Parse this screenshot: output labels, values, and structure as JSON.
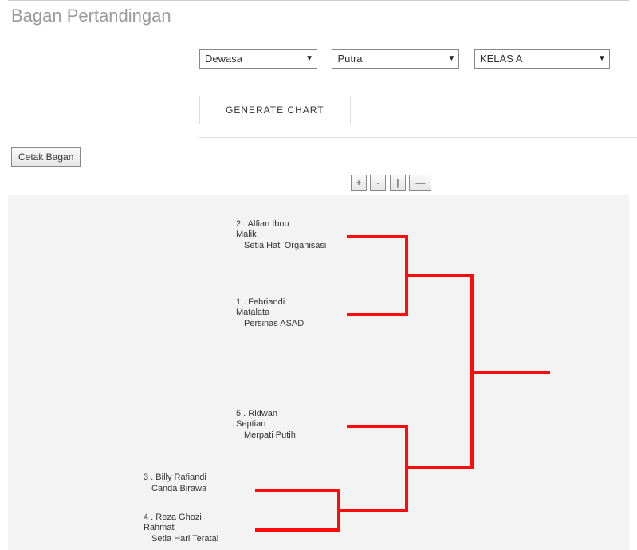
{
  "header": {
    "title": "Bagan Pertandingan"
  },
  "filters": {
    "age_group": {
      "selected": "Dewasa"
    },
    "gender": {
      "selected": "Putra"
    },
    "class": {
      "selected": "KELAS A"
    }
  },
  "actions": {
    "generate": "GENERATE CHART",
    "print": "Cetak Bagan"
  },
  "zoom": {
    "in": "+",
    "out": "-",
    "reset": "|",
    "fit": "—"
  },
  "bracket": {
    "entries": [
      {
        "seed_line": "2 . Alfian Ibnu",
        "name2": "Malik",
        "club": "Setia Hati Organisasi"
      },
      {
        "seed_line": "1 . Febriandi",
        "name2": "Matalata",
        "club": "Persinas ASAD"
      },
      {
        "seed_line": "5 . Ridwan",
        "name2": "Septian",
        "club": "Merpati Putih"
      },
      {
        "seed_line": "3 . Billy Rafiandi",
        "name2": "",
        "club": "Canda Birawa"
      },
      {
        "seed_line": "4 . Reza Ghozi",
        "name2": "Rahmat",
        "club": "Setia Hari Teratai"
      }
    ]
  },
  "colors": {
    "bracket_line": "#ff0b0b"
  }
}
